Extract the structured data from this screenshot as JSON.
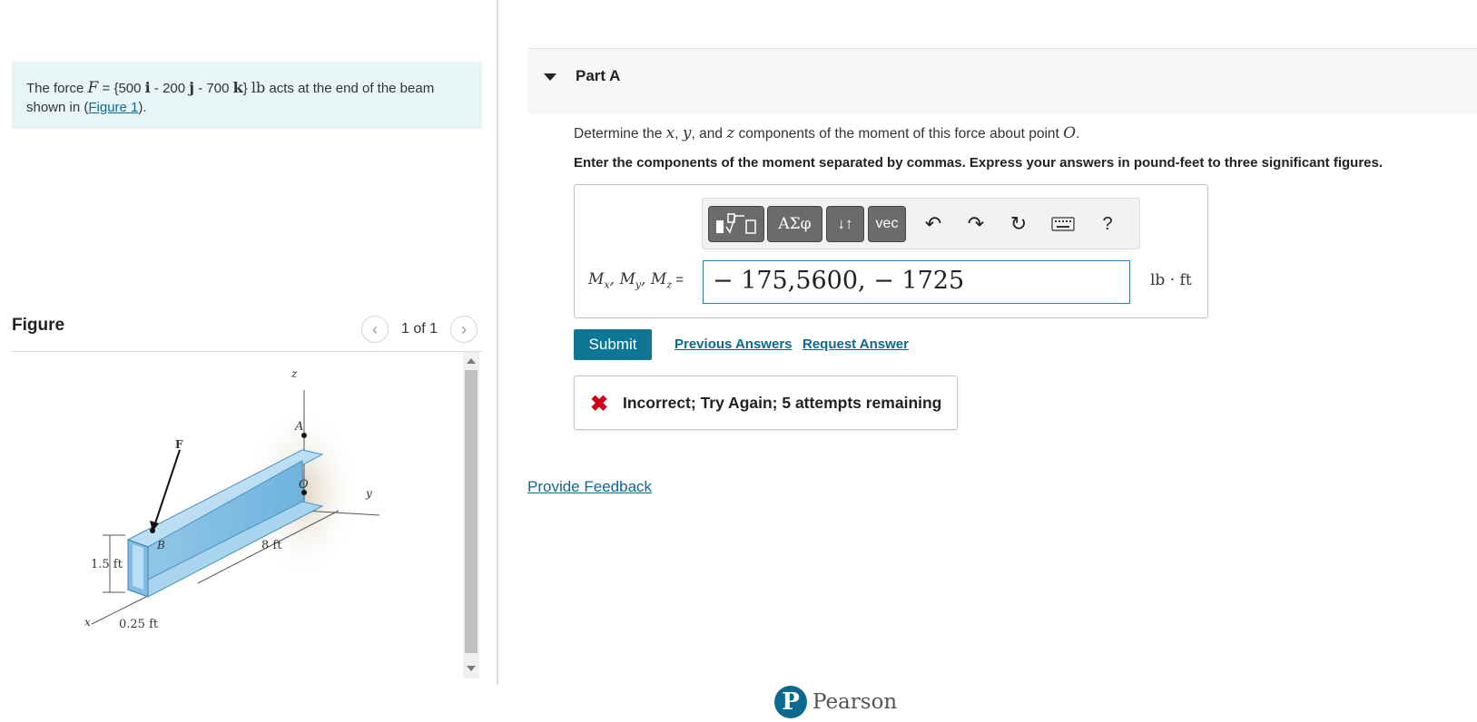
{
  "problem": {
    "text_prefix": "The force",
    "force_symbol": "F",
    "text_eq": " = {500",
    "i": "i",
    "text_mid1": " - 200",
    "j": "j",
    "text_mid2": " - 700",
    "k": "k",
    "text_brace": "}",
    "unit": "lb",
    "text_suffix": " acts at the end of the beam shown in (",
    "figure_link": "Figure 1",
    "text_end": ")."
  },
  "figure": {
    "title": "Figure",
    "pager_text": "1 of 1",
    "prev_icon": "chevron-left-icon",
    "next_icon": "chevron-right-icon",
    "labels": {
      "z": "z",
      "y": "y",
      "x": "x",
      "A": "A",
      "O": "O",
      "B": "B",
      "F": "F",
      "len": "8 ft",
      "height": "1.5 ft",
      "width": "0.25 ft"
    }
  },
  "part": {
    "title": "Part A",
    "question_prefix": "Determine the ",
    "var_x": "x",
    "sep1": ", ",
    "var_y": "y",
    "sep2": ", and ",
    "var_z": "z",
    "question_mid": " components of the moment of this force about point ",
    "point": "O",
    "question_end": ".",
    "instruction": "Enter the components of the moment separated by commas. Express your answers in pound-feet to three significant figures."
  },
  "toolbar": {
    "btn_templates": "templates-icon",
    "btn_greek": "ΑΣφ",
    "btn_arrows": "↓↑",
    "btn_vec": "vec",
    "undo_icon": "undo-icon",
    "redo_icon": "redo-icon",
    "reset_icon": "reset-icon",
    "keyboard_icon": "keyboard-icon",
    "help": "?"
  },
  "answer": {
    "label_m1": "M",
    "sub_x": "x",
    "label_m2": "M",
    "sub_y": "y",
    "label_m3": "M",
    "sub_z": "z",
    "label_eq": " =",
    "value": "− 175,5600, − 1725",
    "unit": "lb · ft"
  },
  "actions": {
    "submit": "Submit",
    "previous_answers": "Previous Answers",
    "request_answer": "Request Answer"
  },
  "feedback": {
    "icon": "✖",
    "message": "Incorrect; Try Again; 5 attempts remaining"
  },
  "provide_feedback": "Provide Feedback",
  "brand": {
    "logo_letter": "P",
    "name": "Pearson"
  }
}
